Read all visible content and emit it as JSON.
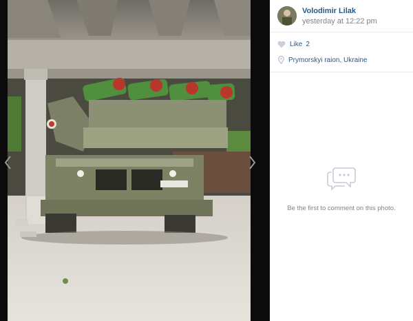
{
  "post": {
    "author_name": "Volodimir Lilak",
    "timestamp": "yesterday at 12:22 pm",
    "photo_subject": "military-vehicle-under-shelter"
  },
  "likes": {
    "label": "Like",
    "count": "2"
  },
  "location": {
    "text": "Prymorskyi raion, Ukraine"
  },
  "comments": {
    "empty_text": "Be the first to comment on this photo."
  },
  "icons": {
    "like": "heart-icon",
    "location": "location-pin-icon",
    "comments": "speech-bubbles-icon",
    "prev": "chevron-left-icon",
    "next": "chevron-right-icon"
  },
  "colors": {
    "link": "#2a5885",
    "muted": "#828282",
    "icon": "#c8d0da",
    "background": "#000000",
    "panel": "#ffffff"
  }
}
